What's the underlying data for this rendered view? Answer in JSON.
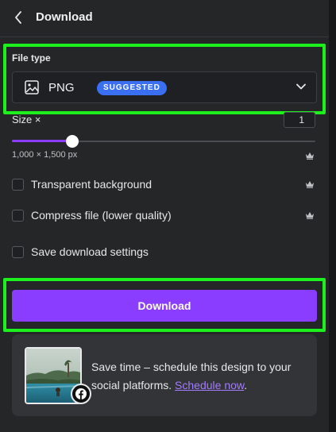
{
  "header": {
    "title": "Download"
  },
  "file_type": {
    "label": "File type",
    "selected": "PNG",
    "badge": "SUGGESTED"
  },
  "size": {
    "label": "Size ×",
    "value": "1",
    "dimensions": "1,000 × 1,500 px",
    "slider_fraction": 0.2
  },
  "options": [
    {
      "label": "Transparent background",
      "checked": false,
      "premium": true
    },
    {
      "label": "Compress file (lower quality)",
      "checked": false,
      "premium": true
    },
    {
      "label": "Save download settings",
      "checked": false,
      "premium": false
    }
  ],
  "download_button": "Download",
  "promo": {
    "text": "Save time – schedule this design to your social platforms.",
    "link": "Schedule now",
    "tail": "."
  },
  "colors": {
    "accent": "#8b3dff",
    "badge": "#3a6ff2",
    "highlight": "#1ef01e",
    "link": "#a47bff"
  }
}
